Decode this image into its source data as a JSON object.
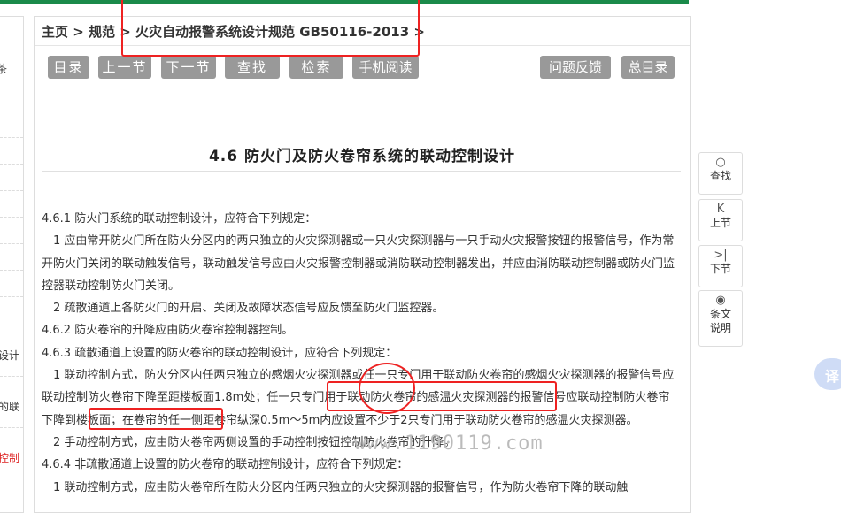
{
  "breadcrumb": "主页 > 规范 > 火灾自动报警系统设计规范 GB50116-2013 >",
  "toolbar": {
    "catalog": "目录",
    "prev": "上一节",
    "next": "下一节",
    "find": "查找",
    "search": "检索",
    "mobile": "手机阅读",
    "feedback": "问题反馈",
    "toc": "总目录"
  },
  "left_panel": {
    "items": [
      "茶",
      "设计",
      "的联",
      "控制"
    ]
  },
  "section_title": "4.6 防火门及防火卷帘系统的联动控制设计",
  "paragraphs": [
    "4.6.1 防火门系统的联动控制设计，应符合下列规定：",
    "1 应由常开防火门所在防火分区内的两只独立的火灾探测器或一只火灾探测器与一只手动火灾报警按钮的报警信号，作为常开防火门关闭的联动触发信号，联动触发信号应由火灾报警控制器或消防联动控制器发出，并应由消防联动控制器或防火门监控器联动控制防火门关闭。",
    "2 疏散通道上各防火门的开启、关闭及故障状态信号应反馈至防火门监控器。",
    "4.6.2 防火卷帘的升降应由防火卷帘控制器控制。",
    "4.6.3 疏散通道上设置的防火卷帘的联动控制设计，应符合下列规定：",
    "1 联动控制方式，防火分区内任两只独立的感烟火灾探测器或任一只专门用于联动防火卷帘的感烟火灾探测器的报警信号应联动控制防火卷帘下降至距楼板面1.8m处；任一只专门用于联动防火卷帘的感温火灾探测器的报警信号应联动控制防火卷帘下降到楼板面；在卷帘的任一侧距卷帘纵深0.5m～5m内应设置不少于2只专门用于联动防火卷帘的感温火灾探测器。",
    "2 手动控制方式，应由防火卷帘两侧设置的手动控制按钮控制防火卷帘的升降。",
    "4.6.4 非疏散通道上设置的防火卷帘的联动控制设计，应符合下列规定：",
    "1 联动控制方式，应由防火卷帘所在防火分区内任两只独立的火灾探测器的报警信号，作为防火卷帘下降的联动触"
  ],
  "watermark": "www.1190119.com",
  "side": {
    "search": "查找",
    "prev": "上节",
    "next": "下节",
    "explain_line1": "条文",
    "explain_line2": "说明"
  },
  "translate_label": "译",
  "colors": {
    "top_bar": "#1a8a4a",
    "button": "#999999",
    "annotation": "#ee2222"
  }
}
